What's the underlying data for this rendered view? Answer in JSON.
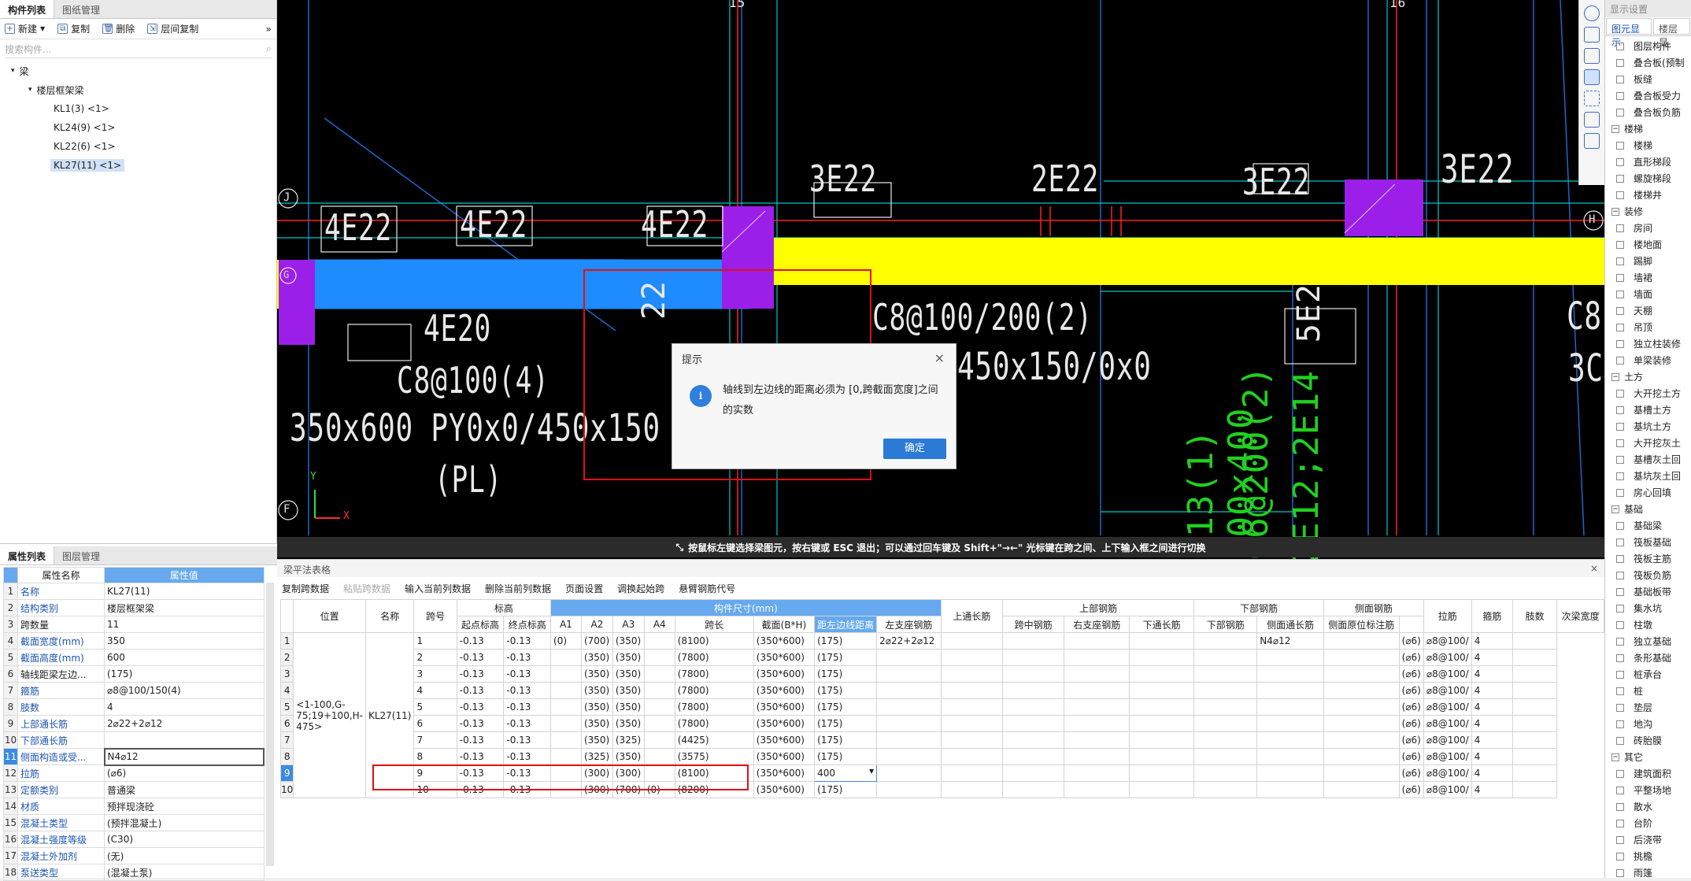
{
  "left": {
    "tabs": [
      "构件列表",
      "图纸管理"
    ],
    "toolbar": {
      "new": "新建",
      "copy": "复制",
      "delete": "删除",
      "floor_copy": "层间复制",
      "more": "»"
    },
    "search_placeholder": "搜索构件...",
    "tree": {
      "root": "梁",
      "group": "楼层框架梁",
      "items": [
        "KL1(3) <1>",
        "KL24(9) <1>",
        "KL22(6) <1>",
        "KL27(11) <1>"
      ]
    }
  },
  "prop": {
    "tabs": [
      "属性列表",
      "图层管理"
    ],
    "col_name": "属性名称",
    "col_value": "属性值",
    "rows": [
      {
        "n": "1",
        "k": "名称",
        "v": "KL27(11)"
      },
      {
        "n": "2",
        "k": "结构类别",
        "v": "楼层框架梁"
      },
      {
        "n": "3",
        "k": "跨数量",
        "v": "11"
      },
      {
        "n": "4",
        "k": "截面宽度(mm)",
        "v": "350"
      },
      {
        "n": "5",
        "k": "截面高度(mm)",
        "v": "600"
      },
      {
        "n": "6",
        "k": "轴线距梁左边...",
        "v": "(175)"
      },
      {
        "n": "7",
        "k": "箍筋",
        "v": "⌀8@100/150(4)"
      },
      {
        "n": "8",
        "k": "肢数",
        "v": "4"
      },
      {
        "n": "9",
        "k": "上部通长筋",
        "v": "2⌀22+2⌀12"
      },
      {
        "n": "10",
        "k": "下部通长筋",
        "v": ""
      },
      {
        "n": "11",
        "k": "侧面构造或受...",
        "v": "N4⌀12"
      },
      {
        "n": "12",
        "k": "拉筋",
        "v": "(⌀6)"
      },
      {
        "n": "13",
        "k": "定额类别",
        "v": "普通梁"
      },
      {
        "n": "14",
        "k": "材质",
        "v": "预拌现浇砼"
      },
      {
        "n": "15",
        "k": "混凝土类型",
        "v": "(预拌混凝土)"
      },
      {
        "n": "16",
        "k": "混凝土强度等级",
        "v": "(C30)"
      },
      {
        "n": "17",
        "k": "混凝土外加剂",
        "v": "(无)"
      },
      {
        "n": "18",
        "k": "泵送类型",
        "v": "(混凝土泵)"
      }
    ]
  },
  "cad": {
    "axis_15": "15",
    "axis_16": "16",
    "axis_16b": "16",
    "axis_J": "J",
    "axis_H": "H",
    "axis_F": "F",
    "axis_G": "G",
    "labels": {
      "a": "4E22",
      "b": "4E22",
      "c": "4E22",
      "d": "3E22",
      "e": "2E22",
      "f": "3E22",
      "g": "3E22",
      "h": "4E20",
      "i": "C8@100(4)",
      "j": "350x600 PY0x0/450x150",
      "k": "(PL)",
      "l": "C8@100/200(2)",
      "m": "450x150/0x0",
      "n": "5E2",
      "o": "C8",
      "p": "3C",
      "q": "L13(1) 200x400",
      "r": "C6@200(2)",
      "s": "2E12;2E14",
      "t": "22"
    },
    "axis_x": "X",
    "axis_y": "Y",
    "status": "按鼠标左键选择梁图元，按右键或 ESC 退出；可以通过回车键及 Shift+\"→←\" 光标键在跨之间、上下输入框之间进行切换"
  },
  "dialog": {
    "title": "提示",
    "close": "×",
    "icon": "i",
    "message": "轴线到左边线的距离必须为 [0,跨截面宽度]之间的实数",
    "ok": "确定"
  },
  "right": {
    "header": "显示设置",
    "tabs": [
      "图元显示",
      "楼层显"
    ],
    "items": [
      {
        "t": "图层构件",
        "s": false
      },
      {
        "t": "叠合板(预制",
        "s": false
      },
      {
        "t": "板缝",
        "s": false
      },
      {
        "t": "叠合板受力",
        "s": false
      },
      {
        "t": "叠合板负筋",
        "s": false
      },
      {
        "t": "楼梯",
        "s": true
      },
      {
        "t": "楼梯",
        "s": false
      },
      {
        "t": "直形梯段",
        "s": false
      },
      {
        "t": "螺旋梯段",
        "s": false
      },
      {
        "t": "楼梯井",
        "s": false
      },
      {
        "t": "装修",
        "s": true
      },
      {
        "t": "房间",
        "s": false
      },
      {
        "t": "楼地面",
        "s": false
      },
      {
        "t": "踢脚",
        "s": false
      },
      {
        "t": "墙裙",
        "s": false
      },
      {
        "t": "墙面",
        "s": false
      },
      {
        "t": "天棚",
        "s": false
      },
      {
        "t": "吊顶",
        "s": false
      },
      {
        "t": "独立柱装修",
        "s": false
      },
      {
        "t": "单梁装修",
        "s": false
      },
      {
        "t": "土方",
        "s": true
      },
      {
        "t": "大开挖土方",
        "s": false
      },
      {
        "t": "基槽土方",
        "s": false
      },
      {
        "t": "基坑土方",
        "s": false
      },
      {
        "t": "大开挖灰土",
        "s": false
      },
      {
        "t": "基槽灰土回",
        "s": false
      },
      {
        "t": "基坑灰土回",
        "s": false
      },
      {
        "t": "房心回填",
        "s": false
      },
      {
        "t": "基础",
        "s": true
      },
      {
        "t": "基础梁",
        "s": false
      },
      {
        "t": "筏板基础",
        "s": false
      },
      {
        "t": "筏板主筋",
        "s": false
      },
      {
        "t": "筏板负筋",
        "s": false
      },
      {
        "t": "基础板带",
        "s": false
      },
      {
        "t": "集水坑",
        "s": false
      },
      {
        "t": "柱墩",
        "s": false
      },
      {
        "t": "独立基础",
        "s": false
      },
      {
        "t": "条形基础",
        "s": false
      },
      {
        "t": "桩承台",
        "s": false
      },
      {
        "t": "桩",
        "s": false
      },
      {
        "t": "垫层",
        "s": false
      },
      {
        "t": "地沟",
        "s": false
      },
      {
        "t": "砖胎膜",
        "s": false
      },
      {
        "t": "其它",
        "s": true
      },
      {
        "t": "建筑面积",
        "s": false
      },
      {
        "t": "平整场地",
        "s": false
      },
      {
        "t": "散水",
        "s": false
      },
      {
        "t": "台阶",
        "s": false
      },
      {
        "t": "后浇带",
        "s": false
      },
      {
        "t": "挑檐",
        "s": false
      },
      {
        "t": "雨篷",
        "s": false
      }
    ]
  },
  "bottom": {
    "title": "梁平法表格",
    "close": "×",
    "toolbar": [
      "复制跨数据",
      "粘贴跨数据",
      "输入当前列数据",
      "删除当前列数据",
      "页面设置",
      "调换起始跨",
      "悬臂钢筋代号"
    ],
    "head1": {
      "pos": "位置",
      "name": "名称",
      "span": "跨号",
      "elev": "标高",
      "size": "构件尺寸(mm)",
      "top_through": "上通长筋",
      "top": "上部钢筋",
      "bot": "下部钢筋",
      "side": "侧面钢筋",
      "tie": "拉筋",
      "stirrup": "箍筋",
      "legs": "肢数",
      "sub": "次梁宽度"
    },
    "head2": {
      "e1": "起点标高",
      "e2": "终点标高",
      "a1": "A1",
      "a2": "A2",
      "a3": "A3",
      "a4": "A4",
      "len": "跨长",
      "sec": "截面(B*H)",
      "dist": "距左边线距离",
      "t1": "左支座钢筋",
      "t2": "跨中钢筋",
      "t3": "右支座钢筋",
      "b1": "下通长筋",
      "b2": "下部钢筋",
      "s1": "侧面通长筋",
      "s2": "侧面原位标注筋"
    },
    "pos_text": "<1-100,G-75;19+100,H-475>",
    "name_text": "KL27(11)",
    "top_text": "2⌀22+2⌀12",
    "side_text": "N4⌀12",
    "rows": [
      {
        "rn": "1",
        "span": "1",
        "e1": "-0.13",
        "e2": "-0.13",
        "a1": "(0)",
        "a2": "(700)",
        "a3": "(350)",
        "a4": "",
        "len": "(8100)",
        "sec": "(350*600)",
        "dist": "(175)",
        "tie": "(⌀6)",
        "stir": "⌀8@100/",
        "legs": "4"
      },
      {
        "rn": "2",
        "span": "2",
        "e1": "-0.13",
        "e2": "-0.13",
        "a1": "",
        "a2": "(350)",
        "a3": "(350)",
        "a4": "",
        "len": "(7800)",
        "sec": "(350*600)",
        "dist": "(175)",
        "tie": "(⌀6)",
        "stir": "⌀8@100/",
        "legs": "4"
      },
      {
        "rn": "3",
        "span": "3",
        "e1": "-0.13",
        "e2": "-0.13",
        "a1": "",
        "a2": "(350)",
        "a3": "(350)",
        "a4": "",
        "len": "(7800)",
        "sec": "(350*600)",
        "dist": "(175)",
        "tie": "(⌀6)",
        "stir": "⌀8@100/",
        "legs": "4"
      },
      {
        "rn": "4",
        "span": "4",
        "e1": "-0.13",
        "e2": "-0.13",
        "a1": "",
        "a2": "(350)",
        "a3": "(350)",
        "a4": "",
        "len": "(7800)",
        "sec": "(350*600)",
        "dist": "(175)",
        "tie": "(⌀6)",
        "stir": "⌀8@100/",
        "legs": "4"
      },
      {
        "rn": "5",
        "span": "5",
        "e1": "-0.13",
        "e2": "-0.13",
        "a1": "",
        "a2": "(350)",
        "a3": "(350)",
        "a4": "",
        "len": "(7800)",
        "sec": "(350*600)",
        "dist": "(175)",
        "tie": "(⌀6)",
        "stir": "⌀8@100/",
        "legs": "4"
      },
      {
        "rn": "6",
        "span": "6",
        "e1": "-0.13",
        "e2": "-0.13",
        "a1": "",
        "a2": "(350)",
        "a3": "(350)",
        "a4": "",
        "len": "(7800)",
        "sec": "(350*600)",
        "dist": "(175)",
        "tie": "(⌀6)",
        "stir": "⌀8@100/",
        "legs": "4"
      },
      {
        "rn": "7",
        "span": "7",
        "e1": "-0.13",
        "e2": "-0.13",
        "a1": "",
        "a2": "(350)",
        "a3": "(325)",
        "a4": "",
        "len": "(4425)",
        "sec": "(350*600)",
        "dist": "(175)",
        "tie": "(⌀6)",
        "stir": "⌀8@100/",
        "legs": "4"
      },
      {
        "rn": "8",
        "span": "8",
        "e1": "-0.13",
        "e2": "-0.13",
        "a1": "",
        "a2": "(325)",
        "a3": "(350)",
        "a4": "",
        "len": "(3575)",
        "sec": "(350*600)",
        "dist": "(175)",
        "tie": "(⌀6)",
        "stir": "⌀8@100/",
        "legs": "4"
      },
      {
        "rn": "9",
        "span": "9",
        "e1": "-0.13",
        "e2": "-0.13",
        "a1": "",
        "a2": "(300)",
        "a3": "(300)",
        "a4": "",
        "len": "(8100)",
        "sec": "(350*600)",
        "dist": "400",
        "tie": "(⌀6)",
        "stir": "⌀8@100/",
        "legs": "4"
      },
      {
        "rn": "10",
        "span": "10",
        "e1": "-0.13",
        "e2": "-0.13",
        "a1": "",
        "a2": "(300)",
        "a3": "(700)",
        "a4": "(0)",
        "len": "(8200)",
        "sec": "(350*600)",
        "dist": "(175)",
        "tie": "(⌀6)",
        "stir": "⌀8@100/",
        "legs": "4"
      }
    ]
  }
}
